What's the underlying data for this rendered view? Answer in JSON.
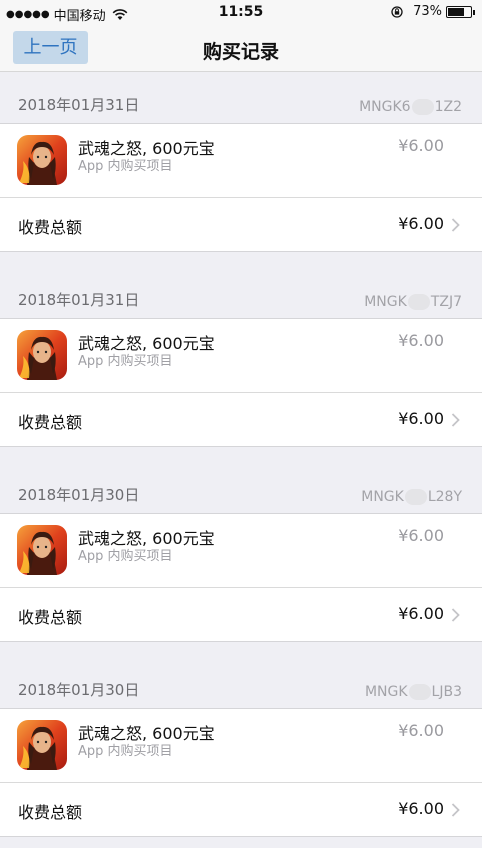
{
  "status_bar": {
    "signal_dots": "●●●●●",
    "carrier": "中国移动",
    "time": "11:55",
    "battery_percent": "73%",
    "battery_level": 0.73
  },
  "nav": {
    "back_label": "上一页",
    "title": "购买记录"
  },
  "purchases": [
    {
      "date": "2018年01月31日",
      "order_id_prefix": "MNGK6",
      "order_id_suffix": "1Z2",
      "item_name": "武魂之怒, 600元宝",
      "item_sub": "App 内购买项目",
      "item_price": "¥6.00",
      "total_label": "收费总额",
      "total_amount": "¥6.00"
    },
    {
      "date": "2018年01月31日",
      "order_id_prefix": "MNGK",
      "order_id_suffix": "TZJ7",
      "item_name": "武魂之怒, 600元宝",
      "item_sub": "App 内购买项目",
      "item_price": "¥6.00",
      "total_label": "收费总额",
      "total_amount": "¥6.00"
    },
    {
      "date": "2018年01月30日",
      "order_id_prefix": "MNGK",
      "order_id_suffix": "L28Y",
      "item_name": "武魂之怒, 600元宝",
      "item_sub": "App 内购买项目",
      "item_price": "¥6.00",
      "total_label": "收费总额",
      "total_amount": "¥6.00"
    },
    {
      "date": "2018年01月30日",
      "order_id_prefix": "MNGK",
      "order_id_suffix": "LJB3",
      "item_name": "武魂之怒, 600元宝",
      "item_sub": "App 内购买项目",
      "item_price": "¥6.00",
      "total_label": "收费总额",
      "total_amount": "¥6.00"
    }
  ],
  "colors": {
    "back_button_bg": "#c4d8ea",
    "back_button_text": "#2f74c0",
    "page_bg": "#efeff4"
  },
  "icons": {
    "app_icon": "game-app-icon",
    "chevron": "chevron-right-icon",
    "wifi": "wifi-icon",
    "lock": "orientation-lock-icon",
    "battery": "battery-icon"
  }
}
